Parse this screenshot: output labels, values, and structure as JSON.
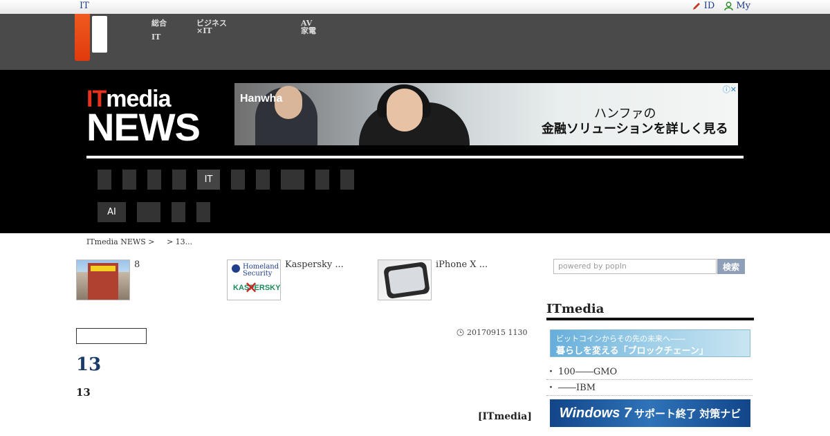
{
  "topbar": {
    "left": "IT",
    "right_items": [
      {
        "label": "ID",
        "icon": "pen-icon"
      },
      {
        "label": "My",
        "icon": "user-icon"
      }
    ]
  },
  "header_links": [
    {
      "line1": "総合",
      "line2": "IT"
    },
    {
      "line1": "ビジネス",
      "line2": "×IT"
    },
    {
      "line1": "AV",
      "line2": "家電"
    }
  ],
  "brand": {
    "top_it": "IT",
    "top_media": "media",
    "bottom": "NEWS"
  },
  "ad": {
    "brand": "Hanwha",
    "line1": "ハンファの",
    "line2": "金融ソリューションを詳しく見る"
  },
  "nav_row1": [
    "",
    "",
    "",
    "",
    "IT",
    "",
    "",
    "",
    "",
    ""
  ],
  "nav_row2": [
    "AI",
    "",
    "",
    ""
  ],
  "breadcrumb": {
    "root": "ITmedia NEWS >",
    "current": "> 13..."
  },
  "related": [
    {
      "text": "8"
    },
    {
      "text": "Kaspersky ..."
    },
    {
      "text": "iPhone X ..."
    }
  ],
  "article": {
    "date": "20170915 1130",
    "title": "13",
    "lead": "13",
    "credit": "[ITmedia]"
  },
  "search": {
    "placeholder": "powered by popIn",
    "button": "検索"
  },
  "sidebar": {
    "heading": "ITmedia",
    "banner1_line1": "ビットコインからその先の未来へ――",
    "banner1_line2": "暮らしを変える「ブロックチェーン」",
    "links": [
      "100――GMO",
      "――IBM"
    ],
    "banner2_main": "Windows 7",
    "banner2_sub": "サポート終了 対策ナビ"
  },
  "colors": {
    "accent": "#e8321e",
    "header_bg": "#4a4a4a",
    "title": "#1a3a6a"
  }
}
